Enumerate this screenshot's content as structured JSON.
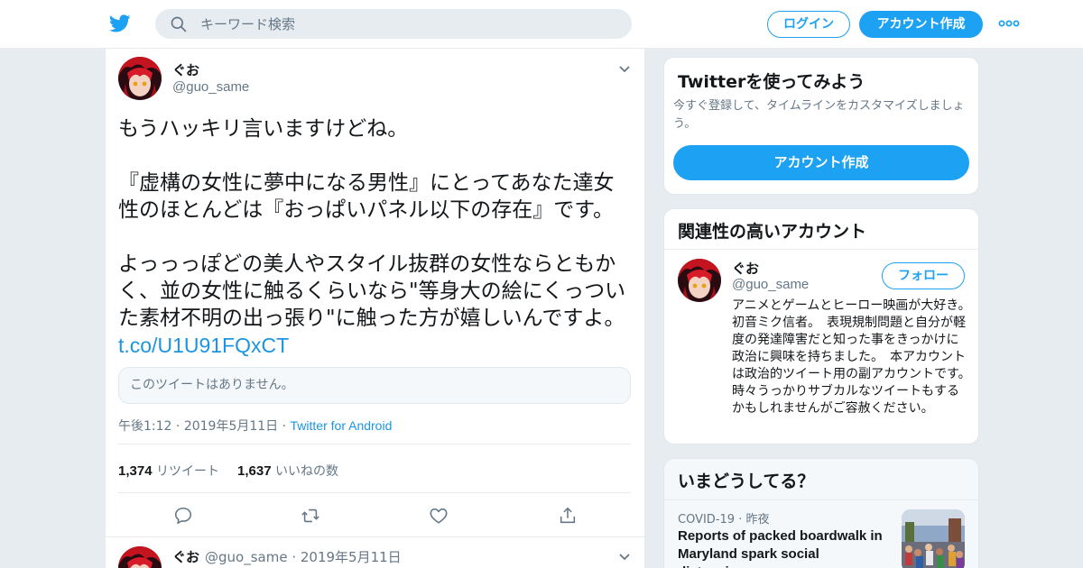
{
  "header": {
    "search_placeholder": "キーワード検索",
    "login_label": "ログイン",
    "signup_label": "アカウント作成"
  },
  "tweet": {
    "author_name": "ぐお",
    "author_handle": "@guo_same",
    "paragraphs": [
      "もうハッキリ言いますけどね。",
      "『虚構の女性に夢中になる男性』にとってあなた達女性のほとんどは『おっぱいパネル以下の存在』です。",
      "よっっっぽどの美人やスタイル抜群の女性ならともかく、並の女性に触るくらいなら\"等身大の絵にくっついた素材不明の出っ張り\"に触った方が嬉しいんですよ。 "
    ],
    "link": "t.co/U1U91FQxCT",
    "quoted_unavailable": "このツイートはありません。",
    "time": "午後1:12",
    "date": "2019年5月11日",
    "source": "Twitter for Android",
    "retweet_count": "1,374",
    "retweet_label": "リツイート",
    "like_count": "1,637",
    "like_label": "いいねの数"
  },
  "next_tweet": {
    "author_name": "ぐお",
    "author_handle": "@guo_same",
    "date": "2019年5月11日"
  },
  "sidebar": {
    "try": {
      "title": "Twitterを使ってみよう",
      "subtitle": "今すぐ登録して、タイムラインをカスタマイズしましょう。",
      "button": "アカウント作成"
    },
    "related": {
      "title": "関連性の高いアカウント",
      "name": "ぐお",
      "handle": "@guo_same",
      "follow_label": "フォロー",
      "bio": "アニメとゲームとヒーロー映画が大好き。　初音ミク信者。　表現規制問題と自分が軽度の発達障害だと知った事をきっかけに政治に興味を持ちました。　本アカウントは政治的ツイート用の副アカウントです。　時々うっかりサブカルなツイートもするかもしれませんがご容赦ください。"
    },
    "whats_happening": {
      "title": "いまどうしてる？",
      "category": "COVID-19",
      "time": "昨夜",
      "headline": "Reports of packed boardwalk in Maryland spark social distancing concerns"
    }
  },
  "colors": {
    "brand": "#1da1f2",
    "link": "#1b95e0",
    "muted": "#657786",
    "background": "#e6ecf0"
  },
  "icons": [
    "twitter-bird-icon",
    "search-icon",
    "more-dots-icon",
    "chevron-down-icon",
    "reply-icon",
    "retweet-icon",
    "like-icon",
    "share-icon"
  ]
}
